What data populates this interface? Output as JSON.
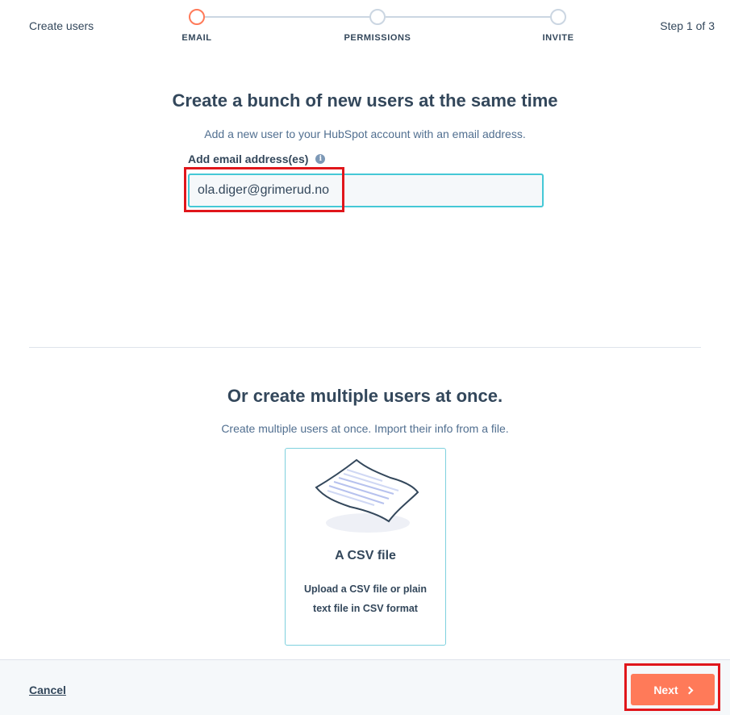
{
  "header": {
    "title": "Create users",
    "step_count": "Step 1 of 3"
  },
  "stepper": {
    "steps": [
      {
        "label": "EMAIL",
        "active": true
      },
      {
        "label": "PERMISSIONS",
        "active": false
      },
      {
        "label": "INVITE",
        "active": false
      }
    ]
  },
  "single": {
    "heading": "Create a bunch of new users at the same time",
    "subtitle": "Add a new user to your HubSpot account with an email address.",
    "field_label": "Add email address(es)",
    "info_icon": "info-icon",
    "email_value": "ola.diger@grimerud.no"
  },
  "multiple": {
    "heading": "Or create multiple users at once.",
    "subtitle": "Create multiple users at once. Import their info from a file.",
    "card_title": "A CSV file",
    "card_description": "Upload a CSV file or plain text file in CSV format"
  },
  "footer": {
    "cancel_label": "Cancel",
    "next_label": "Next"
  },
  "colors": {
    "accent": "#ff7a59",
    "input_border": "#45c8d6",
    "text": "#33475b",
    "highlight": "#e0161b"
  }
}
